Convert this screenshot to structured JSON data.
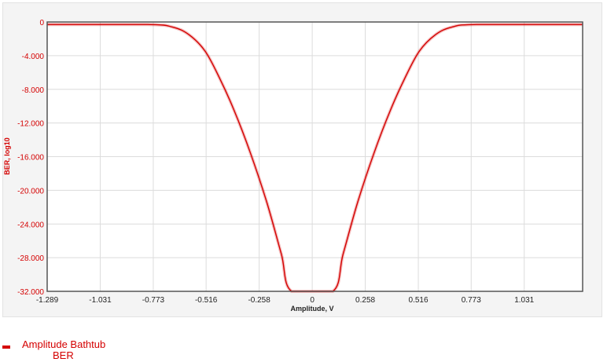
{
  "chart_data": {
    "type": "line",
    "title": "",
    "xlabel": "Amplitude, V",
    "ylabel": "BER, log10",
    "xlim": [
      -1.289,
      1.315
    ],
    "ylim": [
      -32,
      0
    ],
    "x_ticks": [
      -1.289,
      -1.031,
      -0.773,
      -0.516,
      -0.258,
      0,
      0.258,
      0.516,
      0.773,
      1.031
    ],
    "x_tick_labels": [
      "-1.289",
      "-1.031",
      "-0.773",
      "-0.516",
      "-0.258",
      "0",
      "0.258",
      "0.516",
      "0.773",
      "1.031"
    ],
    "y_ticks": [
      0,
      -4,
      -8,
      -12,
      -16,
      -20,
      -24,
      -28,
      -32
    ],
    "y_tick_labels": [
      "0",
      "-4.000",
      "-8.000",
      "-12.000",
      "-16.000",
      "-20.000",
      "-24.000",
      "-28.000",
      "-32.000"
    ],
    "grid": true,
    "legend_position": "bottom-left",
    "series": [
      {
        "name": "BER",
        "color": "#d40000",
        "x": [
          -1.289,
          -0.8,
          -0.68,
          -0.6,
          -0.52,
          -0.45,
          -0.38,
          -0.3,
          -0.22,
          -0.15,
          -0.1,
          0.1,
          0.15,
          0.22,
          0.3,
          0.38,
          0.45,
          0.52,
          0.6,
          0.68,
          0.8,
          1.315
        ],
        "y": [
          -0.3,
          -0.3,
          -0.6,
          -1.5,
          -3.5,
          -6.7,
          -10.5,
          -15.6,
          -21.5,
          -27.6,
          -32,
          -32,
          -27.6,
          -21.5,
          -15.6,
          -10.5,
          -6.7,
          -3.5,
          -1.5,
          -0.6,
          -0.3,
          -0.3
        ]
      }
    ]
  },
  "legend": {
    "title": "Amplitude Bathtub",
    "subtitle": "BER"
  },
  "colors": {
    "series": "#d40000",
    "grid": "#dcdcdc",
    "frame": "#555555"
  }
}
